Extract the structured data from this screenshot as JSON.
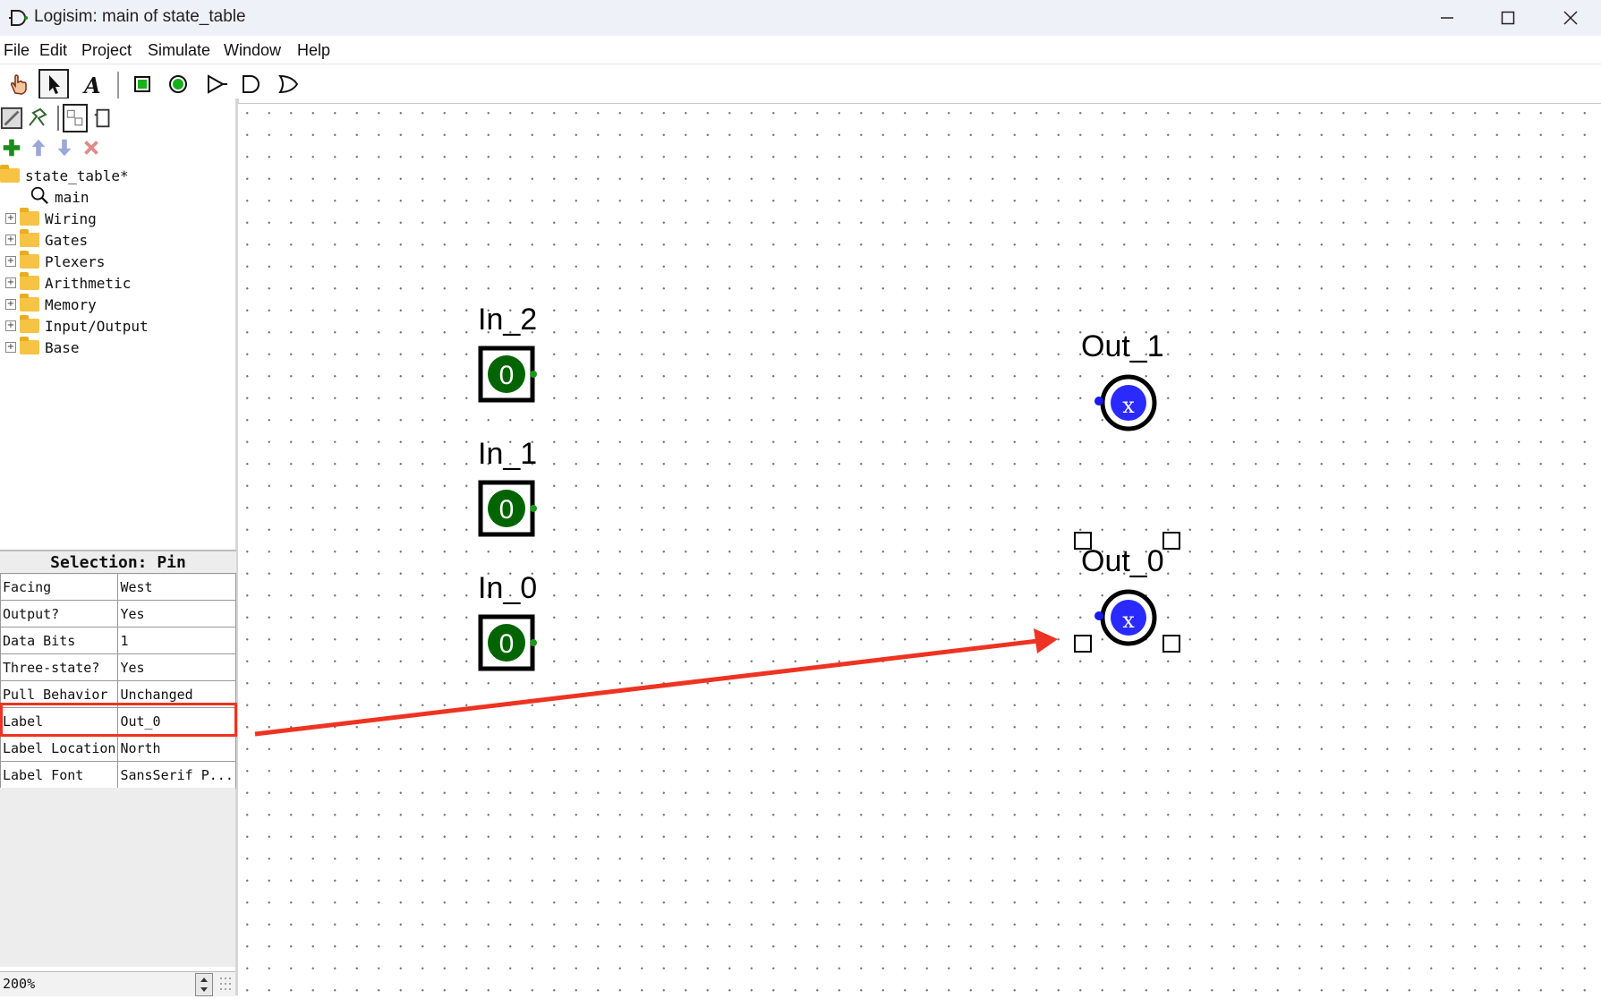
{
  "window": {
    "title": "Logisim: main of state_table"
  },
  "menu": [
    "File",
    "Edit",
    "Project",
    "Simulate",
    "Window",
    "Help"
  ],
  "toolbar": {
    "tools": [
      "poke-tool",
      "select-tool",
      "text-tool",
      "input-pin",
      "output-pin",
      "buffer-gate",
      "and-gate",
      "or-gate"
    ]
  },
  "project_tree": {
    "root": "state_table*",
    "circuit": "main",
    "folders": [
      "Wiring",
      "Gates",
      "Plexers",
      "Arithmetic",
      "Memory",
      "Input/Output",
      "Base"
    ]
  },
  "selection": {
    "header": "Selection: Pin",
    "attributes": [
      {
        "key": "Facing",
        "value": "West"
      },
      {
        "key": "Output?",
        "value": "Yes"
      },
      {
        "key": "Data Bits",
        "value": "1"
      },
      {
        "key": "Three-state?",
        "value": "Yes"
      },
      {
        "key": "Pull Behavior",
        "value": "Unchanged"
      },
      {
        "key": "Label",
        "value": "Out_0"
      },
      {
        "key": "Label Location",
        "value": "North"
      },
      {
        "key": "Label Font",
        "value": "SansSerif P..."
      }
    ]
  },
  "zoom": "200%",
  "canvas": {
    "inputs": [
      {
        "label": "In_2",
        "value": "0"
      },
      {
        "label": "In_1",
        "value": "0"
      },
      {
        "label": "In_0",
        "value": "0"
      }
    ],
    "outputs": [
      {
        "label": "Out_1",
        "value": "x"
      },
      {
        "label": "Out_0",
        "value": "x"
      }
    ]
  },
  "colors": {
    "input_green": "#006400",
    "output_blue": "#2a2aff",
    "annotation_red": "#ee3322"
  }
}
